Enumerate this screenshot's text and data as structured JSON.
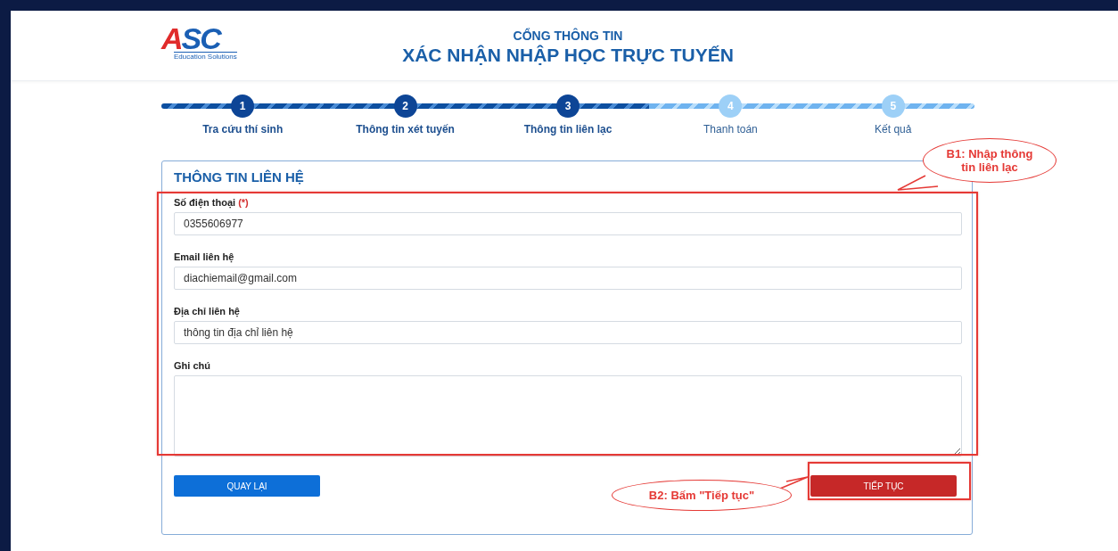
{
  "header": {
    "logo": {
      "mark": "ASC",
      "tagline": "Education Solutions"
    },
    "subtitle": "CỔNG THÔNG TIN",
    "title": "XÁC NHẬN NHẬP HỌC TRỰC TUYẾN"
  },
  "steps": [
    {
      "number": "1",
      "label": "Tra cứu thí sinh",
      "completed": true
    },
    {
      "number": "2",
      "label": "Thông tin xét tuyến",
      "completed": true
    },
    {
      "number": "3",
      "label": "Thông tin liên lạc",
      "completed": true
    },
    {
      "number": "4",
      "label": "Thanh toán",
      "completed": false
    },
    {
      "number": "5",
      "label": "Kết quả",
      "completed": false
    }
  ],
  "form": {
    "title": "THÔNG TIN LIÊN HỆ",
    "fields": [
      {
        "kind": "input",
        "label": "Số điện thoại",
        "required_mark": "(*)",
        "value": "0355606977"
      },
      {
        "kind": "input",
        "label": "Email liên hệ",
        "value": "diachiemail@gmail.com"
      },
      {
        "kind": "input",
        "label": "Địa chỉ liên hệ",
        "value": "thông tin địa chỉ liên hệ"
      },
      {
        "kind": "textarea",
        "label": "Ghi chú"
      }
    ],
    "buttons": [
      {
        "kind": "back",
        "label": "QUAY LẠI"
      },
      {
        "kind": "next",
        "label": "TIẾP TỤC"
      }
    ]
  },
  "annotations": [
    {
      "kind": "form",
      "text": "B1: Nhập thông tin liên lạc"
    },
    {
      "kind": "button",
      "text": "B2: Bấm \"Tiếp tục\""
    }
  ]
}
